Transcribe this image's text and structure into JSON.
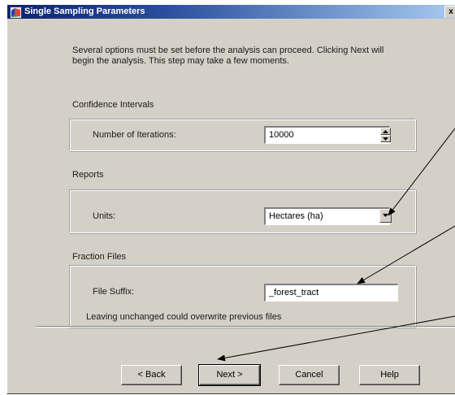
{
  "window": {
    "title": "Single Sampling Parameters",
    "close_glyph": "x"
  },
  "intro_text": "Several options must be set before the analysis can proceed. Clicking Next will begin the analysis. This step may take a few moments.",
  "confidence": {
    "section_label": "Confidence Intervals",
    "iterations_label": "Number of Iterations:",
    "iterations_value": "10000"
  },
  "reports": {
    "section_label": "Reports",
    "units_label": "Units:",
    "units_value": "Hectares (ha)"
  },
  "fraction_files": {
    "section_label": "Fraction Files",
    "suffix_label": "File Suffix:",
    "suffix_value": "_forest_tract",
    "warning": "Leaving unchanged could overwrite previous files"
  },
  "buttons": {
    "back": "< Back",
    "next": "Next >",
    "cancel": "Cancel",
    "help": "Help"
  },
  "icons": {
    "window_icon": "app-window-icon",
    "spin_up": "spin-up-icon",
    "spin_down": "spin-down-icon",
    "dropdown": "dropdown-arrow-icon"
  },
  "colors": {
    "dialog_bg": "#d4d0c8",
    "titlebar_start": "#0a246a",
    "titlebar_end": "#a6caf0"
  }
}
